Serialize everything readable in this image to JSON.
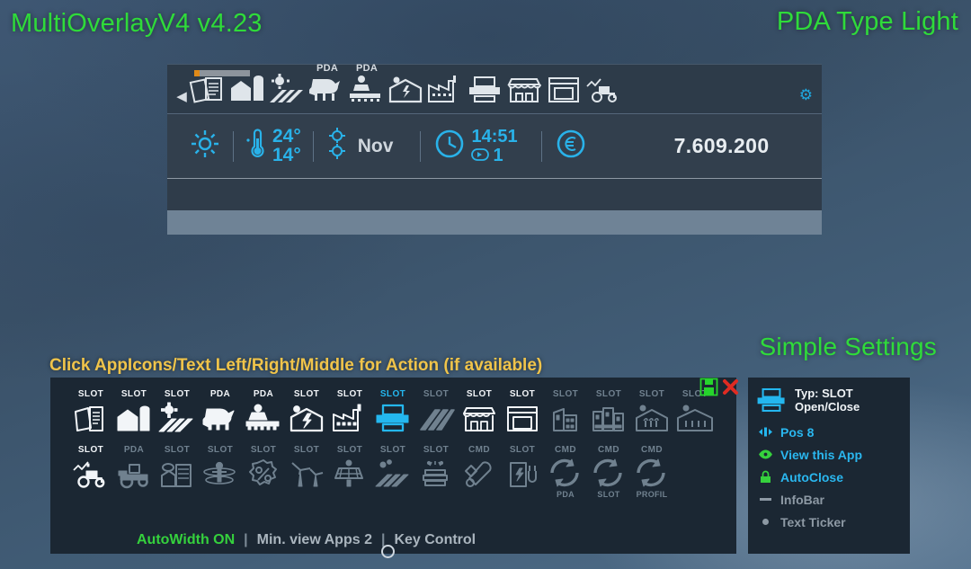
{
  "app_title": "MultiOverlayV4 v4.23",
  "pda_type_label": "PDA Type Light",
  "simple_settings_label": "Simple Settings",
  "hint_text": "Click AppIcons/Text Left/Right/Middle for Action (if available)",
  "colors": {
    "green": "#2fdb3a",
    "cyan": "#24b7ef",
    "yellow": "#f0c44a",
    "panel_bg": "#1b2733",
    "bar_bg": "#2d3b49",
    "info_bg": "#323f4d",
    "ticker_bg": "#6f8396",
    "dim": "#70818f",
    "bright": "#f2f5f8",
    "red": "#e02b22",
    "orange": "#e08a18"
  },
  "pda_bar": {
    "prev_arrow_icon": "chevron-left-icon",
    "gear_icon": "gear-icon",
    "page_pips_total": 10,
    "page_pips_active": 1,
    "icons": [
      {
        "name": "documents-icon",
        "label": ""
      },
      {
        "name": "farm-silo-icon",
        "label": ""
      },
      {
        "name": "field-sun-icon",
        "label": ""
      },
      {
        "name": "animals-icon",
        "label": "PDA"
      },
      {
        "name": "production-worker-icon",
        "label": "PDA"
      },
      {
        "name": "power-barn-icon",
        "label": ""
      },
      {
        "name": "factory-icon",
        "label": ""
      },
      {
        "name": "printer-slot-icon",
        "label": ""
      },
      {
        "name": "shop-icon",
        "label": ""
      },
      {
        "name": "gallery-icon",
        "label": ""
      },
      {
        "name": "tractor-stats-icon",
        "label": ""
      }
    ]
  },
  "info_bar": {
    "weather_icon": "sun-icon",
    "temp_icon": "thermometer-icon",
    "temp_high": "24°",
    "temp_low": "14°",
    "season_icon": "growth-stage-icon",
    "month": "Nov",
    "clock_icon": "clock-icon",
    "time": "14:51",
    "speed_icon": "play-speed-icon",
    "speed": "1",
    "money_icon": "euro-icon",
    "money": "7.609.200"
  },
  "config_panel": {
    "row1": [
      {
        "label": "SLOT",
        "icon": "documents-icon",
        "state": "bright"
      },
      {
        "label": "SLOT",
        "icon": "farm-silo-icon",
        "state": "bright"
      },
      {
        "label": "SLOT",
        "icon": "field-sun-icon",
        "state": "bright"
      },
      {
        "label": "PDA",
        "icon": "animals-icon",
        "state": "bright"
      },
      {
        "label": "PDA",
        "icon": "production-worker-icon",
        "state": "bright"
      },
      {
        "label": "SLOT",
        "icon": "power-barn-icon",
        "state": "bright"
      },
      {
        "label": "SLOT",
        "icon": "factory-icon",
        "state": "bright"
      },
      {
        "label": "SLOT",
        "icon": "printer-slot-icon",
        "state": "active"
      },
      {
        "label": "SLOT",
        "icon": "planks-icon",
        "state": "dim"
      },
      {
        "label": "SLOT",
        "icon": "shop-icon",
        "state": "bright"
      },
      {
        "label": "SLOT",
        "icon": "gallery-icon",
        "state": "bright"
      },
      {
        "label": "SLOT",
        "icon": "building-small-icon",
        "state": "dim"
      },
      {
        "label": "SLOT",
        "icon": "building-large-icon",
        "state": "dim"
      },
      {
        "label": "SLOT",
        "icon": "greenhouse-icon",
        "state": "dim"
      },
      {
        "label": "SLOT",
        "icon": "greenhouse-wide-icon",
        "state": "dim"
      }
    ],
    "row2": [
      {
        "label": "SLOT",
        "icon": "tractor-stats-icon",
        "state": "bright",
        "sublabel": ""
      },
      {
        "label": "PDA",
        "icon": "tractor-icon",
        "state": "dim",
        "sublabel": ""
      },
      {
        "label": "SLOT",
        "icon": "storage-fill-icon",
        "state": "dim",
        "sublabel": ""
      },
      {
        "label": "SLOT",
        "icon": "worker-field-icon",
        "state": "dim",
        "sublabel": ""
      },
      {
        "label": "SLOT",
        "icon": "discount-percent-icon",
        "state": "dim",
        "sublabel": ""
      },
      {
        "label": "SLOT",
        "icon": "wind-turbine-icon",
        "state": "dim",
        "sublabel": ""
      },
      {
        "label": "SLOT",
        "icon": "solar-panel-icon",
        "state": "dim",
        "sublabel": ""
      },
      {
        "label": "SLOT",
        "icon": "seeding-field-icon",
        "state": "dim",
        "sublabel": ""
      },
      {
        "label": "SLOT",
        "icon": "beehive-icon",
        "state": "dim",
        "sublabel": ""
      },
      {
        "label": "CMD",
        "icon": "tools-icon",
        "state": "dim",
        "sublabel": ""
      },
      {
        "label": "SLOT",
        "icon": "charging-station-icon",
        "state": "dim",
        "sublabel": ""
      },
      {
        "label": "CMD",
        "icon": "refresh-icon",
        "state": "dim",
        "sublabel": "PDA"
      },
      {
        "label": "CMD",
        "icon": "refresh-icon",
        "state": "dim",
        "sublabel": "SLOT"
      },
      {
        "label": "CMD",
        "icon": "refresh-icon",
        "state": "dim",
        "sublabel": "PROFIL"
      }
    ],
    "status": {
      "autowidth": "AutoWidth ON",
      "divider": "|",
      "min_view": "Min. view Apps 2",
      "key_control": "Key Control"
    },
    "actions": {
      "save_icon": "save-disk-icon",
      "close_icon": "close-x-icon"
    }
  },
  "settings_panel": {
    "header_icon": "printer-slot-icon",
    "header_line1": "Typ: SLOT",
    "header_line2": "Open/Close",
    "rows": [
      {
        "icon": "position-arrows-icon",
        "label": "Pos 8",
        "style": "cyan"
      },
      {
        "icon": "eye-icon",
        "label": "View this App",
        "style": "cyan"
      },
      {
        "icon": "lock-icon",
        "label": "AutoClose",
        "style": "cyan"
      },
      {
        "icon": "dash-icon",
        "label": "InfoBar",
        "style": "grey"
      },
      {
        "icon": "dot-icon",
        "label": "Text Ticker",
        "style": "grey"
      }
    ]
  }
}
